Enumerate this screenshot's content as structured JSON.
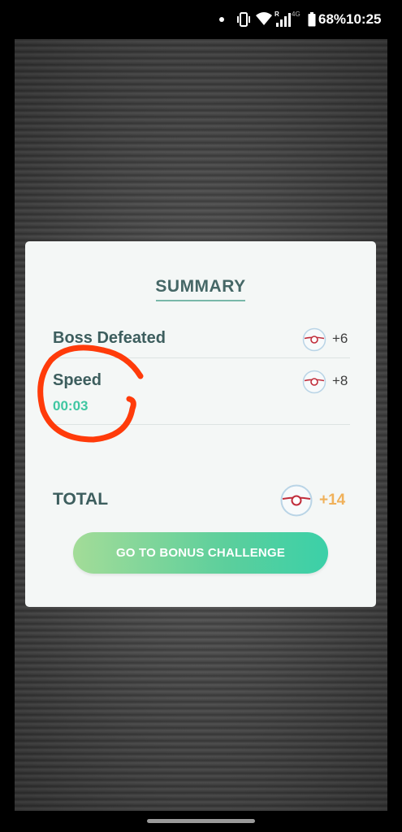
{
  "status_bar": {
    "battery_percent": "68%",
    "time": "10:25",
    "signal_label": "4G",
    "icons": [
      "notification-dot-icon",
      "vibrate-icon",
      "wifi-icon",
      "signal-icon",
      "battery-icon"
    ]
  },
  "summary": {
    "title": "SUMMARY",
    "rows": [
      {
        "label": "Boss Defeated",
        "reward": "+6",
        "icon": "premier-ball-icon"
      },
      {
        "label": "Speed",
        "time": "00:03",
        "reward": "+8",
        "icon": "premier-ball-icon"
      }
    ],
    "total_label": "TOTAL",
    "total_reward": "+14"
  },
  "button": {
    "label": "GO TO BONUS CHALLENGE"
  },
  "colors": {
    "accent_green": "#3fc7a2",
    "total_orange": "#f0b15a",
    "annotation_red": "#ff3b0a"
  }
}
